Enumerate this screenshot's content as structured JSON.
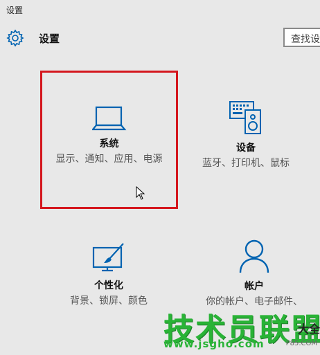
{
  "window": {
    "title": "设置"
  },
  "header": {
    "title": "设置",
    "search_placeholder": "查找设置"
  },
  "tiles": [
    {
      "title": "系统",
      "desc": "显示、通知、应用、电源",
      "icon": "laptop-icon"
    },
    {
      "title": "设备",
      "desc": "蓝牙、打印机、鼠标",
      "icon": "keyboard-speaker-icon"
    },
    {
      "title": "个性化",
      "desc": "背景、锁屏、颜色",
      "icon": "monitor-brush-icon"
    },
    {
      "title": "帐户",
      "desc": "你的帐户、电子邮件、",
      "icon": "person-icon"
    }
  ],
  "watermark": {
    "main": "技术员联盟",
    "side": "大全",
    "sub": "www.jsgho.com",
    "small": "P85.COM"
  },
  "colors": {
    "accent": "#0063b1",
    "highlight_border": "#d4171e",
    "watermark_green": "#29b336"
  }
}
